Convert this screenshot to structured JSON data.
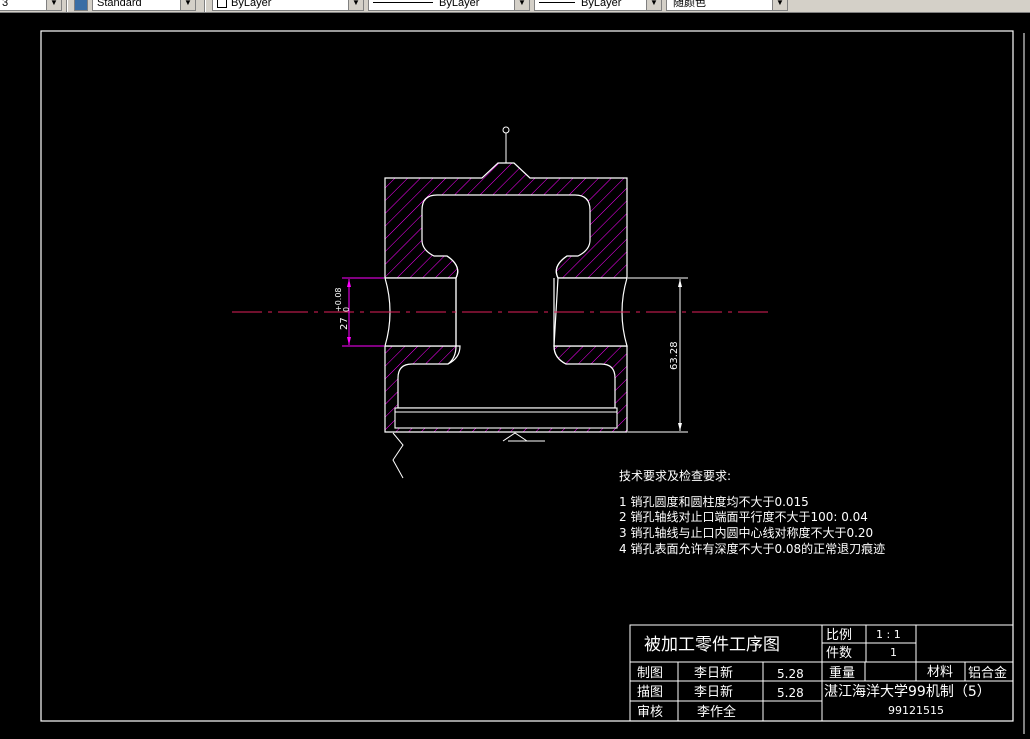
{
  "toolbar": {
    "linetype_prefix": "3",
    "text_style": "Standard",
    "layer": "ByLayer",
    "linetype": "ByLayer",
    "lineweight": "ByLayer",
    "color": "随颜色"
  },
  "drawing": {
    "dimensions": {
      "hole_tolerance": "+0.08",
      "hole_tolerance_base": "0",
      "hole_size": "27",
      "height": "63.28"
    },
    "tech_requirements": {
      "title": "技术要求及检查要求:",
      "items": [
        "1 销孔圆度和圆柱度均不大于0.015",
        "2 销孔轴线对止口端面平行度不大于100: 0.04",
        "3 销孔轴线与止口内圆中心线对称度不大于0.20",
        "4 销孔表面允许有深度不大于0.08的正常退刀痕迹"
      ]
    },
    "title_block": {
      "drawing_title": "被加工零件工序图",
      "scale_label": "比例",
      "scale_value": "1 : 1",
      "count_label": "件数",
      "count_value": "1",
      "weight_label": "重量",
      "material_label": "材料",
      "material_value": "铝合金",
      "rows": [
        {
          "role": "制图",
          "name": "李日新",
          "date": "5.28"
        },
        {
          "role": "描图",
          "name": "李日新",
          "date": "5.28"
        },
        {
          "role": "审核",
          "name": "李作全",
          "date": ""
        }
      ],
      "school": "湛江海洋大学99机制（5）",
      "student_id": "99121515"
    }
  },
  "colors": {
    "background": "#000000",
    "outline": "#ffffff",
    "hatch": "#ff00ff",
    "centerline": "#e0205a",
    "dimension": "#ff00ff"
  }
}
